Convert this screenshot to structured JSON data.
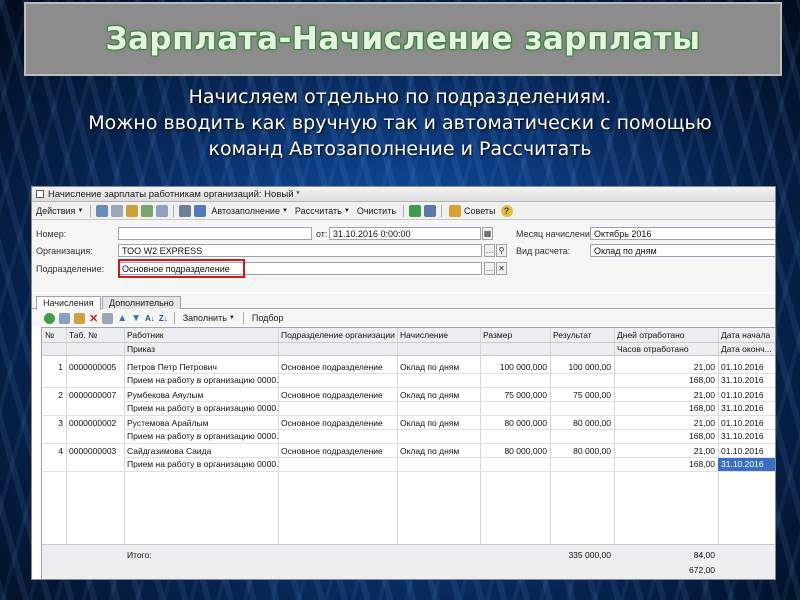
{
  "slide": {
    "title": "Зарплата-Начисление зарплаты",
    "subtitle_lines": [
      "Начисляем отдельно по подразделениям.",
      "Можно вводить как вручную так и автоматически с помощью",
      "команд Автозаполнение и Рассчитать"
    ]
  },
  "window": {
    "title": "Начисление зарплаты работникам организаций: Новый *"
  },
  "toolbar": {
    "actions": "Действия",
    "autofill": "Автозаполнение",
    "calculate": "Рассчитать",
    "clear": "Очистить",
    "tips": "Советы"
  },
  "form": {
    "number_label": "Номер:",
    "number_value": "",
    "from_label": "от:",
    "from_value": "31.10.2016 0:00:00",
    "month_label": "Месяц начисления:",
    "month_value": "Октябрь 2016",
    "org_label": "Организация:",
    "org_value": "ТОО W2 EXPRESS",
    "calc_type_label": "Вид расчета:",
    "calc_type_value": "Оклад по дням",
    "dept_label": "Подразделение:",
    "dept_value": "Основное подразделение"
  },
  "tabs": [
    "Начисления",
    "Дополнительно"
  ],
  "table_toolbar": {
    "fill": "Заполнить",
    "select": "Подбор"
  },
  "table": {
    "headers_top": [
      "№",
      "Таб. №",
      "Работник",
      "Подразделение организации",
      "Начисление",
      "Размер",
      "Результат",
      "Дней отработано",
      "Дата начала"
    ],
    "headers_bottom": [
      "Приказ",
      "Часов отработано",
      "Дата оконч..."
    ],
    "rows": [
      {
        "n": "1",
        "tab": "0000000005",
        "worker": "Петров Петр Петрович",
        "order": "Прием на работу в организацию 0000...",
        "dept": "Основное подразделение",
        "accrual": "Оклад по дням",
        "size": "100 000,000",
        "result": "100 000,00",
        "days": "21,00",
        "hours": "168,00",
        "start": "01.10.2016",
        "end": "31.10.2016"
      },
      {
        "n": "2",
        "tab": "0000000007",
        "worker": "Румбекова Аяулым",
        "order": "Прием на работу в организацию 0000...",
        "dept": "Основное подразделение",
        "accrual": "Оклад по дням",
        "size": "75 000,000",
        "result": "75 000,00",
        "days": "21,00",
        "hours": "168,00",
        "start": "01.10.2016",
        "end": "31.10.2016"
      },
      {
        "n": "3",
        "tab": "0000000002",
        "worker": "Рустемова Арайлым",
        "order": "Прием на работу в организацию 0000...",
        "dept": "Основное подразделение",
        "accrual": "Оклад по дням",
        "size": "80 000,000",
        "result": "80 000,00",
        "days": "21,00",
        "hours": "168,00",
        "start": "01.10.2016",
        "end": "31.10.2016"
      },
      {
        "n": "4",
        "tab": "0000000003",
        "worker": "Сайдгазимова Саида",
        "order": "Прием на работу в организацию 0000...",
        "dept": "Основное подразделение",
        "accrual": "Оклад по дням",
        "size": "80 000,000",
        "result": "80 000,00",
        "days": "21,00",
        "hours": "168,00",
        "start": "01.10.2016",
        "end": "31.10.2016"
      }
    ],
    "total_label": "Итого:",
    "total_result": "335 000,00",
    "total_days": "84,00",
    "total_hours": "672,00"
  },
  "colors": {
    "highlight": "#d01818",
    "selection": "#3a6fc5"
  }
}
